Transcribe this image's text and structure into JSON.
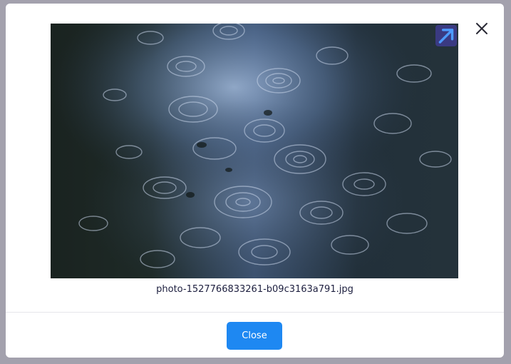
{
  "modal": {
    "close_x_icon": "close-icon",
    "image": {
      "description_icon": "photo",
      "open_icon": "arrow-up-right-icon"
    },
    "caption": "photo-1527766833261-b09c3163a791.jpg",
    "footer": {
      "close_label": "Close"
    }
  },
  "colors": {
    "overlay": "#a3a1ad",
    "modal_bg": "#ffffff",
    "primary_button": "#1e88f2",
    "open_button_bg": "#3a3a82",
    "caption_text": "#1d1f3f"
  }
}
